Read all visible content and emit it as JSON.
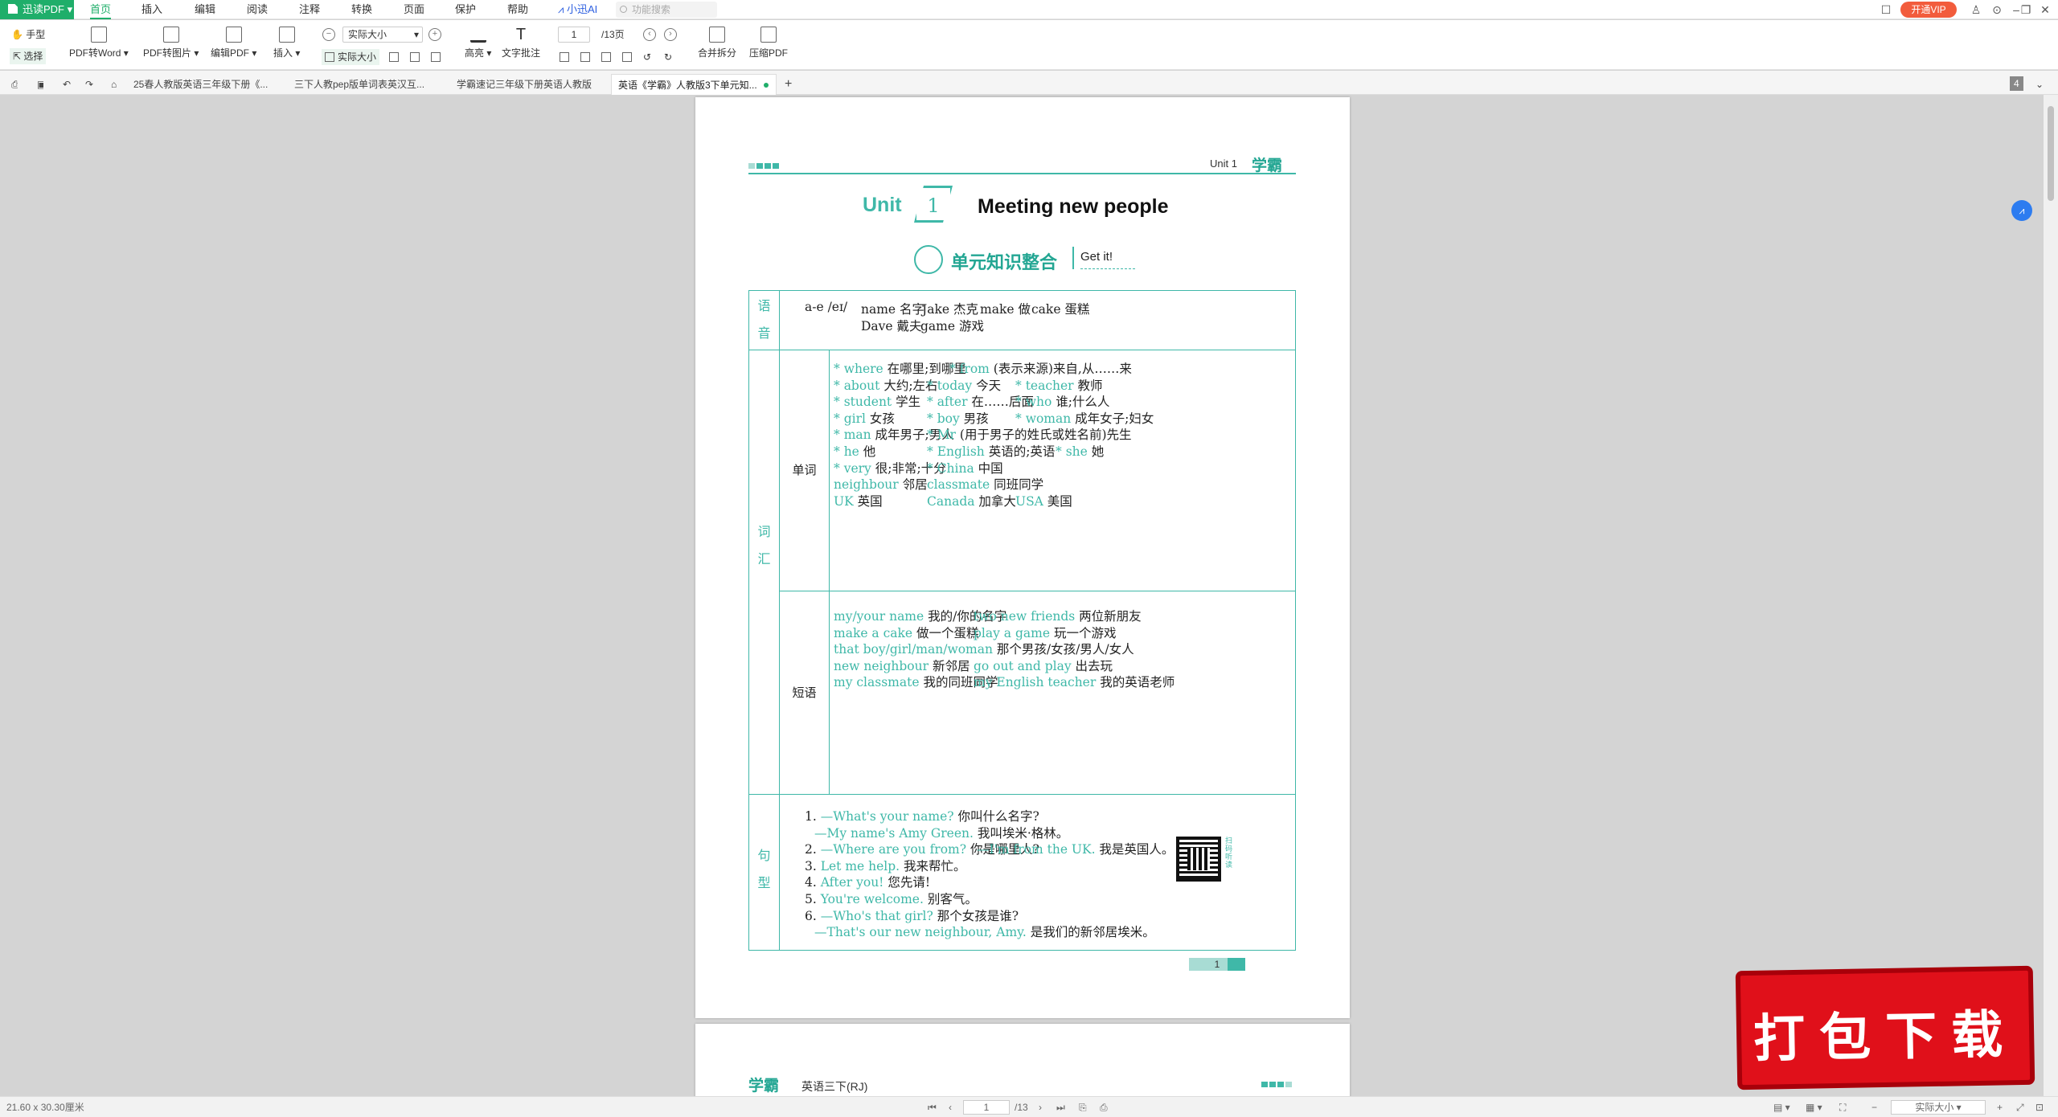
{
  "app": {
    "name": "迅读PDF",
    "menus": [
      "首页",
      "插入",
      "编辑",
      "阅读",
      "注释",
      "转换",
      "页面",
      "保护",
      "帮助",
      "小迅AI"
    ],
    "search_placeholder": "功能搜索",
    "vip": "开通VIP"
  },
  "toolbar": {
    "hand": "手型",
    "select": "选择",
    "pdf_to_word": "PDF转Word",
    "pdf_to_image": "PDF转图片",
    "edit_pdf": "编辑PDF",
    "insert": "插入",
    "zoom_value": "实际大小",
    "actual_size": "实际大小",
    "highlight": "高亮",
    "text_note": "文字批注",
    "page_current": "1",
    "page_total": "/13页",
    "merge_split": "合并拆分",
    "compress": "压缩PDF"
  },
  "tabs": [
    "25春人教版英语三年级下册《...",
    "三下人教pep版单词表英汉互...",
    "学霸速记三年级下册英语人教版",
    "英语《学霸》人教版3下单元知..."
  ],
  "tab_count": "4",
  "doc": {
    "brand": "学霸",
    "unit_label": "Unit 1",
    "unit_word": "Unit",
    "unit_no": "1",
    "unit_title": "Meeting new people",
    "section_title": "单元知识整合",
    "section_sub": "Get it!",
    "cat_phonics": [
      "语",
      "音"
    ],
    "cat_vocab": [
      "词",
      "汇"
    ],
    "cat_sentence": [
      "句",
      "型"
    ],
    "sub_words": "单词",
    "sub_phrases": "短语",
    "phonics": [
      [
        "a-e /eɪ/",
        ""
      ],
      [
        "name",
        "名字"
      ],
      [
        "Jake",
        "杰克"
      ],
      [
        "make",
        "做"
      ],
      [
        "cake",
        "蛋糕"
      ],
      [
        "Dave",
        "戴夫"
      ],
      [
        "game",
        "游戏"
      ]
    ],
    "words": [
      [
        "where",
        "在哪里;到哪里"
      ],
      [
        "from",
        "(表示来源)来自,从……来"
      ],
      [
        "about",
        "大约;左右"
      ],
      [
        "today",
        "今天"
      ],
      [
        "teacher",
        "教师"
      ],
      [
        "student",
        "学生"
      ],
      [
        "after",
        "在……后面"
      ],
      [
        "who",
        "谁;什么人"
      ],
      [
        "girl",
        "女孩"
      ],
      [
        "boy",
        "男孩"
      ],
      [
        "woman",
        "成年女子;妇女"
      ],
      [
        "man",
        "成年男子;男人"
      ],
      [
        "Mr",
        "(用于男子的姓氏或姓名前)先生"
      ],
      [
        "he",
        "他"
      ],
      [
        "English",
        "英语的;英语"
      ],
      [
        "she",
        "她"
      ],
      [
        "very",
        "很;非常;十分"
      ],
      [
        "China",
        "中国"
      ],
      [
        "neighbour",
        "邻居"
      ],
      [
        "classmate",
        "同班同学"
      ],
      [
        "UK",
        "英国"
      ],
      [
        "Canada",
        "加拿大"
      ],
      [
        "USA",
        "美国"
      ]
    ],
    "phrases": [
      [
        "my/your name",
        "我的/你的名字"
      ],
      [
        "two new friends",
        "两位新朋友"
      ],
      [
        "make a cake",
        "做一个蛋糕"
      ],
      [
        "play a game",
        "玩一个游戏"
      ],
      [
        "that boy/girl/man/woman",
        "那个男孩/女孩/男人/女人"
      ],
      [
        "new neighbour",
        "新邻居"
      ],
      [
        "go out and play",
        "出去玩"
      ],
      [
        "my classmate",
        "我的同班同学"
      ],
      [
        "my English teacher",
        "我的英语老师"
      ]
    ],
    "sentences": [
      [
        "1.",
        "—What's your name?",
        "你叫什么名字?"
      ],
      [
        "",
        "—My name's Amy Green.",
        "我叫埃米·格林。"
      ],
      [
        "2.",
        "—Where are you from?",
        "你是哪里人?"
      ],
      [
        "",
        "—I'm from the UK.",
        "我是英国人。"
      ],
      [
        "3.",
        "Let me help.",
        "我来帮忙。"
      ],
      [
        "4.",
        "After you!",
        "您先请!"
      ],
      [
        "5.",
        "You're welcome.",
        "别客气。"
      ],
      [
        "6.",
        "—Who's that girl?",
        "那个女孩是谁?"
      ],
      [
        "",
        "—That's our new neighbour, Amy.",
        "是我们的新邻居埃米。"
      ]
    ],
    "qr_label": "扫码听读",
    "page_number": "1",
    "page2_brand": "学霸",
    "page2_title": "英语三下(RJ)"
  },
  "status": {
    "size": "21.60 x 30.30厘米",
    "page_current": "1",
    "page_total": "/13",
    "zoom": "实际大小"
  },
  "watermark": "打包下载",
  "colors": {
    "accent": "#1fae6a",
    "teal": "#3fb8a8",
    "vip": "#f25c3c"
  }
}
